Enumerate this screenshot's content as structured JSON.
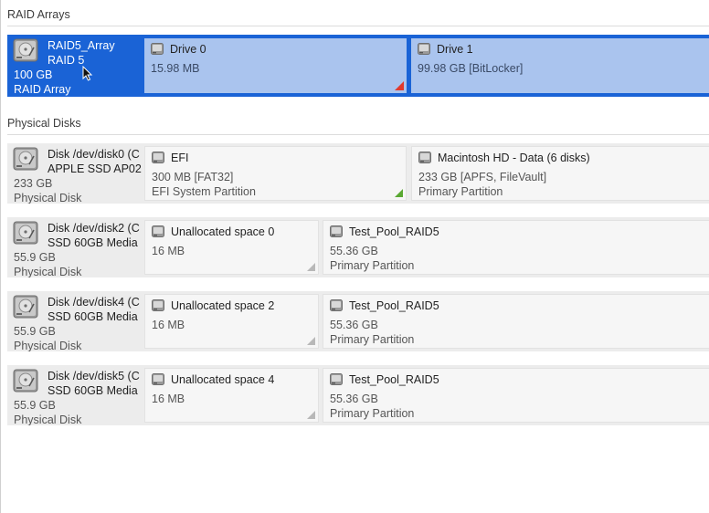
{
  "raid_section": {
    "title": "RAID Arrays"
  },
  "raid_array": {
    "name_line1": "RAID5_Array",
    "name_line2": "RAID 5",
    "size": "100 GB",
    "kind": "RAID Array",
    "drives": [
      {
        "name": "Drive 0",
        "size": "15.98 MB",
        "marker_color": "#e03a2e"
      },
      {
        "name": "Drive 1",
        "size": "99.98 GB [BitLocker]"
      }
    ]
  },
  "physical_section": {
    "title": "Physical Disks"
  },
  "disks": [
    {
      "name_line1": "Disk /dev/disk0 (C",
      "name_line2": "APPLE SSD AP02",
      "size": "233 GB",
      "kind": "Physical Disk",
      "partitions": [
        {
          "name": "EFI",
          "size": "300 MB [FAT32]",
          "type": "EFI System Partition",
          "marker_color": "#5aa832"
        },
        {
          "name": "Macintosh HD - Data (6 disks)",
          "size": "233 GB [APFS, FileVault]",
          "type": "Primary Partition"
        }
      ]
    },
    {
      "name_line1": "Disk /dev/disk2 (C",
      "name_line2": "SSD 60GB Media",
      "size": "55.9 GB",
      "kind": "Physical Disk",
      "partitions": [
        {
          "name": "Unallocated space 0",
          "size": "16 MB",
          "marker_color": "#b8b8b8"
        },
        {
          "name": "Test_Pool_RAID5",
          "size": "55.36 GB",
          "type": "Primary Partition"
        }
      ]
    },
    {
      "name_line1": "Disk /dev/disk4 (C",
      "name_line2": "SSD 60GB Media",
      "size": "55.9 GB",
      "kind": "Physical Disk",
      "partitions": [
        {
          "name": "Unallocated space 2",
          "size": "16 MB",
          "marker_color": "#b8b8b8"
        },
        {
          "name": "Test_Pool_RAID5",
          "size": "55.36 GB",
          "type": "Primary Partition"
        }
      ]
    },
    {
      "name_line1": "Disk /dev/disk5 (C",
      "name_line2": "SSD 60GB Media",
      "size": "55.9 GB",
      "kind": "Physical Disk",
      "partitions": [
        {
          "name": "Unallocated space 4",
          "size": "16 MB",
          "marker_color": "#b8b8b8"
        },
        {
          "name": "Test_Pool_RAID5",
          "size": "55.36 GB",
          "type": "Primary Partition"
        }
      ]
    }
  ]
}
